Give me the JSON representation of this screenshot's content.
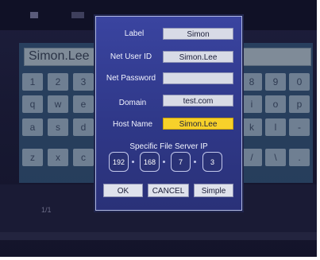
{
  "keyboard": {
    "input_text": "Simon.Lee",
    "page_indicator": "1/1",
    "keys_left": [
      "1",
      "2",
      "3",
      "q",
      "w",
      "e",
      "a",
      "s",
      "d",
      "z",
      "x",
      "c"
    ],
    "keys_right": [
      "8",
      "9",
      "0",
      "i",
      "o",
      "p",
      "k",
      "l",
      "-",
      "/",
      "\\",
      "."
    ]
  },
  "dialog": {
    "label": {
      "label": "Label",
      "value": "Simon"
    },
    "net_user_id": {
      "label": "Net User ID",
      "value": "Simon.Lee"
    },
    "net_password": {
      "label": "Net Password",
      "value": ""
    },
    "domain": {
      "label": "Domain",
      "value": "test.com"
    },
    "host_name": {
      "label": "Host Name",
      "value": "Simon.Lee"
    },
    "file_server_ip": {
      "title": "Specific File Server IP",
      "octets": [
        "192",
        "168",
        "7",
        "3"
      ]
    },
    "buttons": {
      "ok": "OK",
      "cancel": "CANCEL",
      "simple": "Simple"
    }
  },
  "colors": {
    "dialog_bg": "#2f3888",
    "highlight": "#f7d12a",
    "field_bg": "#d8dbe6"
  }
}
